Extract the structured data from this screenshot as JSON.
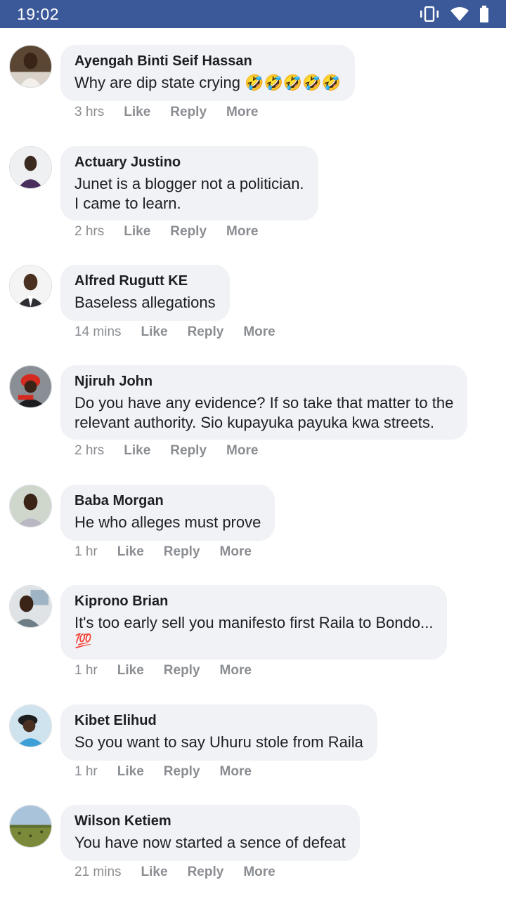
{
  "status_bar": {
    "time": "19:02",
    "icons": [
      "vibrate-icon",
      "wifi-icon",
      "battery-icon"
    ],
    "bar_color": "#3b5998"
  },
  "actions": {
    "like": "Like",
    "reply": "Reply",
    "more": "More"
  },
  "comments": [
    {
      "author": "Ayengah Binti Seif Hassan",
      "lines": [
        "Why are dip state crying 🤣🤣🤣🤣🤣"
      ],
      "time": "3 hrs"
    },
    {
      "author": "Actuary Justino",
      "lines": [
        "Junet is a blogger not a politician.",
        "I came to learn."
      ],
      "time": "2 hrs"
    },
    {
      "author": "Alfred Rugutt KE",
      "lines": [
        "Baseless allegations"
      ],
      "time": "14 mins"
    },
    {
      "author": "Njiruh John",
      "lines": [
        "Do you have any evidence? If so take that matter to the",
        "relevant authority. Sio kupayuka payuka kwa streets."
      ],
      "time": "2 hrs"
    },
    {
      "author": "Baba Morgan",
      "lines": [
        "He who alleges must prove"
      ],
      "time": "1 hr"
    },
    {
      "author": "Kiprono Brian",
      "lines": [
        "It's too early sell you manifesto first Raila to Bondo...",
        "💯"
      ],
      "time": "1 hr"
    },
    {
      "author": "Kibet Elihud",
      "lines": [
        "So you want to say Uhuru stole from Raila"
      ],
      "time": "1 hr"
    },
    {
      "author": "Wilson Ketiem",
      "lines": [
        "You have now started a sence of defeat"
      ],
      "time": "21 mins"
    }
  ]
}
